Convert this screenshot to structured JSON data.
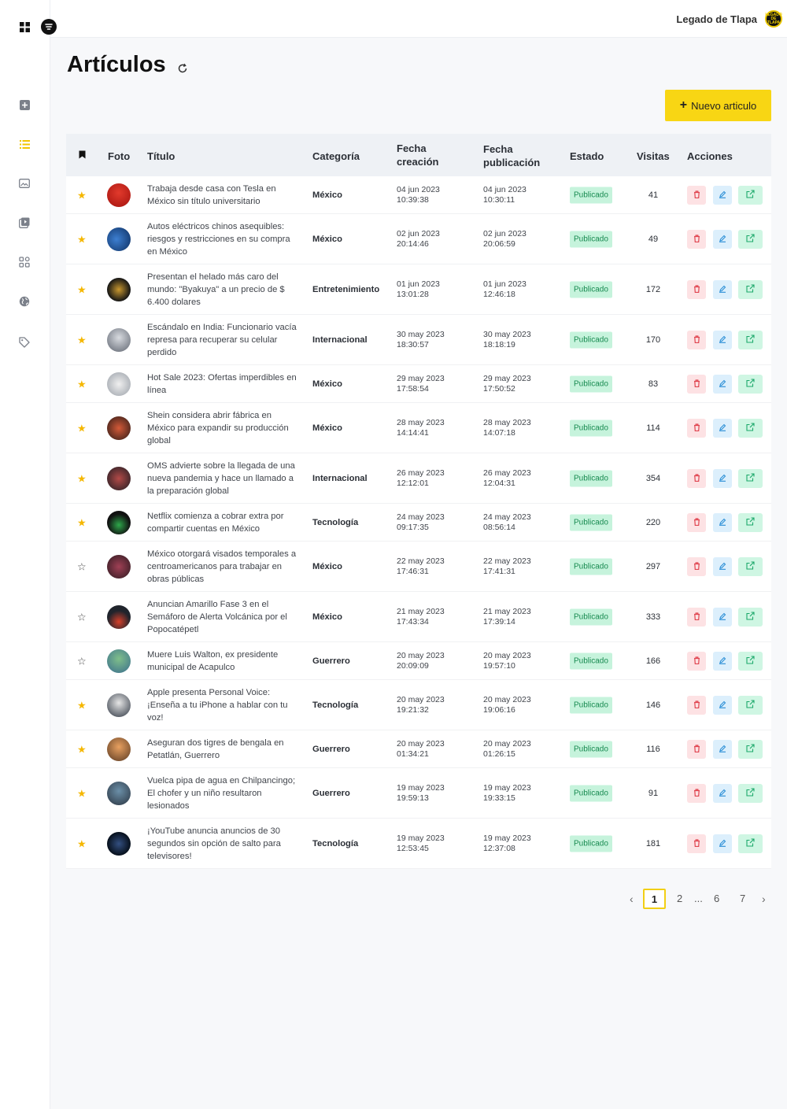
{
  "header": {
    "brand_name": "Legado de Tlapa",
    "avatar_text": "LEGADO DE TLAPA"
  },
  "page": {
    "title": "Artículos",
    "new_button_label": "Nuevo articulo"
  },
  "colors": {
    "accent": "#f8d614",
    "status_bg": "#c6f3dc",
    "status_text": "#178a50",
    "delete_bg": "#fde2e4",
    "edit_bg": "#dceffc",
    "open_bg": "#cff6e3"
  },
  "table": {
    "headers": {
      "photo": "Foto",
      "title": "Título",
      "category": "Categoría",
      "created_line1": "Fecha",
      "created_line2": "creación",
      "published_line1": "Fecha",
      "published_line2": "publicación",
      "status": "Estado",
      "visits": "Visitas",
      "actions": "Acciones"
    },
    "rows": [
      {
        "featured": true,
        "title": "Trabaja desde casa con Tesla en México sin título universitario",
        "category": "México",
        "created_date": "04 jun 2023",
        "created_time": "10:39:38",
        "published_date": "04 jun 2023",
        "published_time": "10:30:11",
        "status": "Publicado",
        "visits": "41"
      },
      {
        "featured": true,
        "title": "Autos eléctricos chinos asequibles: riesgos y restricciones en su compra en México",
        "category": "México",
        "created_date": "02 jun 2023",
        "created_time": "20:14:46",
        "published_date": "02 jun 2023",
        "published_time": "20:06:59",
        "status": "Publicado",
        "visits": "49"
      },
      {
        "featured": true,
        "title": "Presentan el helado más caro del mundo: \"Byakuya\" a un precio de $ 6.400 dolares",
        "category": "Entretenimiento",
        "created_date": "01 jun 2023",
        "created_time": "13:01:28",
        "published_date": "01 jun 2023",
        "published_time": "12:46:18",
        "status": "Publicado",
        "visits": "172"
      },
      {
        "featured": true,
        "title": "Escándalo en India: Funcionario vacía represa para recuperar su celular perdido",
        "category": "Internacional",
        "created_date": "30 may 2023",
        "created_time": "18:30:57",
        "published_date": "30 may 2023",
        "published_time": "18:18:19",
        "status": "Publicado",
        "visits": "170"
      },
      {
        "featured": true,
        "title": "Hot Sale 2023: Ofertas imperdibles en línea",
        "category": "México",
        "created_date": "29 may 2023",
        "created_time": "17:58:54",
        "published_date": "29 may 2023",
        "published_time": "17:50:52",
        "status": "Publicado",
        "visits": "83"
      },
      {
        "featured": true,
        "title": "Shein considera abrir fábrica en México para expandir su producción global",
        "category": "México",
        "created_date": "28 may 2023",
        "created_time": "14:14:41",
        "published_date": "28 may 2023",
        "published_time": "14:07:18",
        "status": "Publicado",
        "visits": "114"
      },
      {
        "featured": true,
        "title": "OMS advierte sobre la llegada de una nueva pandemia y hace un llamado a la preparación global",
        "category": "Internacional",
        "created_date": "26 may 2023",
        "created_time": "12:12:01",
        "published_date": "26 may 2023",
        "published_time": "12:04:31",
        "status": "Publicado",
        "visits": "354"
      },
      {
        "featured": true,
        "title": "Netflix comienza a cobrar extra por compartir cuentas en México",
        "category": "Tecnología",
        "created_date": "24 may 2023",
        "created_time": "09:17:35",
        "published_date": "24 may 2023",
        "published_time": "08:56:14",
        "status": "Publicado",
        "visits": "220"
      },
      {
        "featured": false,
        "title": "México otorgará visados temporales a centroamericanos para trabajar en obras públicas",
        "category": "México",
        "created_date": "22 may 2023",
        "created_time": "17:46:31",
        "published_date": "22 may 2023",
        "published_time": "17:41:31",
        "status": "Publicado",
        "visits": "297"
      },
      {
        "featured": false,
        "title": "Anuncian Amarillo Fase 3 en el Semáforo de Alerta Volcánica por el Popocatépetl",
        "category": "México",
        "created_date": "21 may 2023",
        "created_time": "17:43:34",
        "published_date": "21 may 2023",
        "published_time": "17:39:14",
        "status": "Publicado",
        "visits": "333"
      },
      {
        "featured": false,
        "title": "Muere Luis Walton, ex presidente municipal de Acapulco",
        "category": "Guerrero",
        "created_date": "20 may 2023",
        "created_time": "20:09:09",
        "published_date": "20 may 2023",
        "published_time": "19:57:10",
        "status": "Publicado",
        "visits": "166"
      },
      {
        "featured": true,
        "title": "Apple presenta Personal Voice: ¡Enseña a tu iPhone a hablar con tu voz!",
        "category": "Tecnología",
        "created_date": "20 may 2023",
        "created_time": "19:21:32",
        "published_date": "20 may 2023",
        "published_time": "19:06:16",
        "status": "Publicado",
        "visits": "146"
      },
      {
        "featured": true,
        "title": "Aseguran dos tigres de bengala en Petatlán, Guerrero",
        "category": "Guerrero",
        "created_date": "20 may 2023",
        "created_time": "01:34:21",
        "published_date": "20 may 2023",
        "published_time": "01:26:15",
        "status": "Publicado",
        "visits": "116"
      },
      {
        "featured": true,
        "title": "Vuelca pipa de agua en Chilpancingo; El chofer y un niño resultaron lesionados",
        "category": "Guerrero",
        "created_date": "19 may 2023",
        "created_time": "19:59:13",
        "published_date": "19 may 2023",
        "published_time": "19:33:15",
        "status": "Publicado",
        "visits": "91"
      },
      {
        "featured": true,
        "title": "¡YouTube anuncia anuncios de 30 segundos sin opción de salto para televisores!",
        "category": "Tecnología",
        "created_date": "19 may 2023",
        "created_time": "12:53:45",
        "published_date": "19 may 2023",
        "published_time": "12:37:08",
        "status": "Publicado",
        "visits": "181"
      }
    ]
  },
  "pagination": {
    "prev_icon": "chevron-left-icon",
    "next_icon": "chevron-right-icon",
    "current": "1",
    "page_2": "2",
    "ellipsis": "...",
    "page_6": "6",
    "page_7": "7"
  }
}
